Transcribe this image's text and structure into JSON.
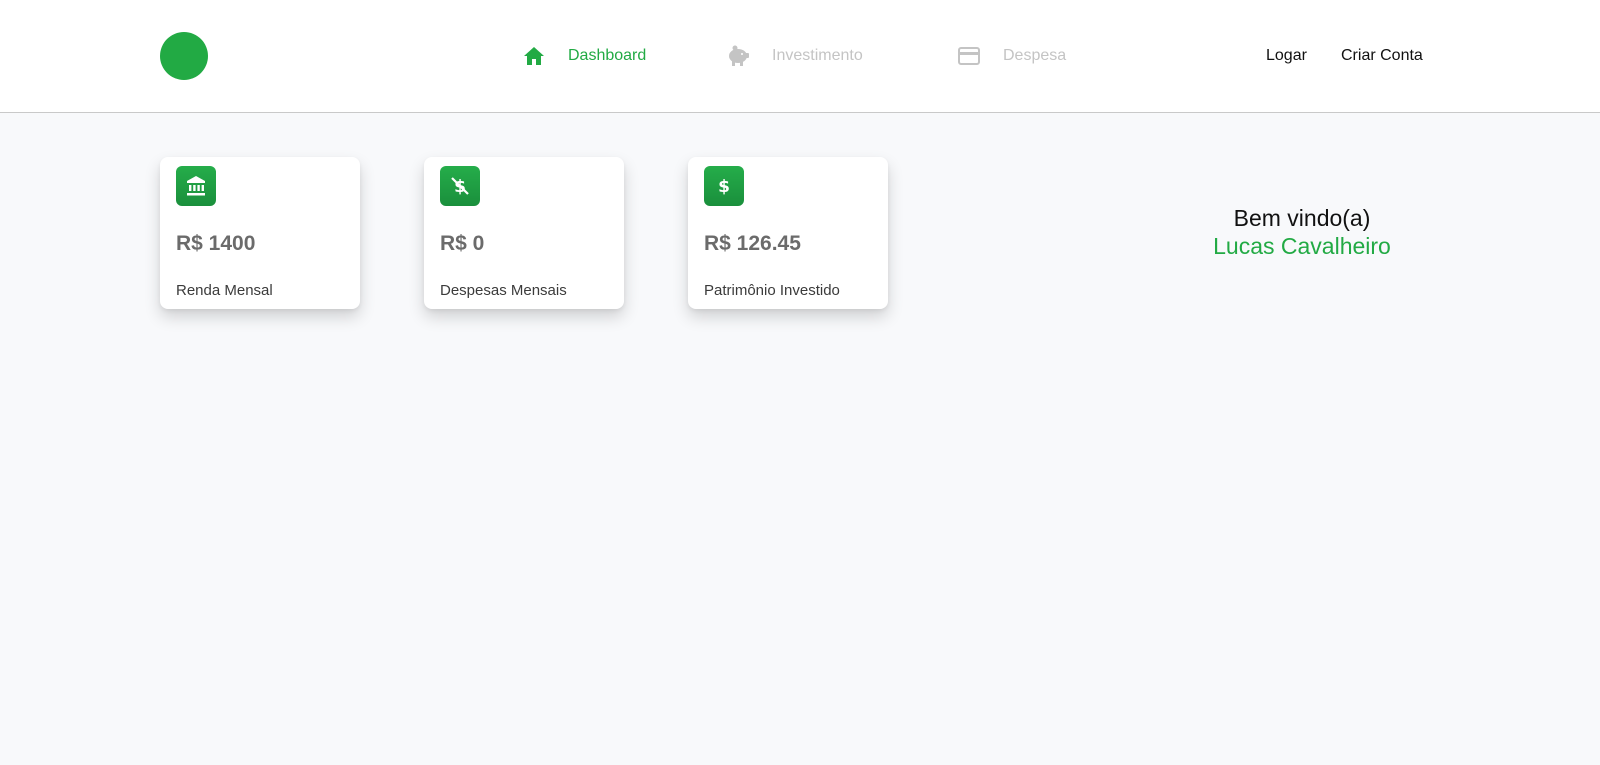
{
  "colors": {
    "accent": "#22aa44",
    "inactive_nav": "#c4c4c4",
    "background": "#f8f9fb"
  },
  "nav": {
    "items": [
      {
        "label": "Dashboard",
        "icon": "home-icon",
        "active": true
      },
      {
        "label": "Investimento",
        "icon": "piggy-bank-icon",
        "active": false
      },
      {
        "label": "Despesa",
        "icon": "credit-card-icon",
        "active": false
      }
    ]
  },
  "auth": {
    "login_label": "Logar",
    "register_label": "Criar Conta"
  },
  "cards": [
    {
      "value": "R$ 1400",
      "label": "Renda Mensal",
      "icon": "bank-icon"
    },
    {
      "value": "R$ 0",
      "label": "Despesas Mensais",
      "icon": "money-off-icon"
    },
    {
      "value": "R$ 126.45",
      "label": "Patrimônio Investido",
      "icon": "dollar-icon"
    }
  ],
  "welcome": {
    "greeting": "Bem vindo(a)",
    "user_name": "Lucas Cavalheiro"
  }
}
